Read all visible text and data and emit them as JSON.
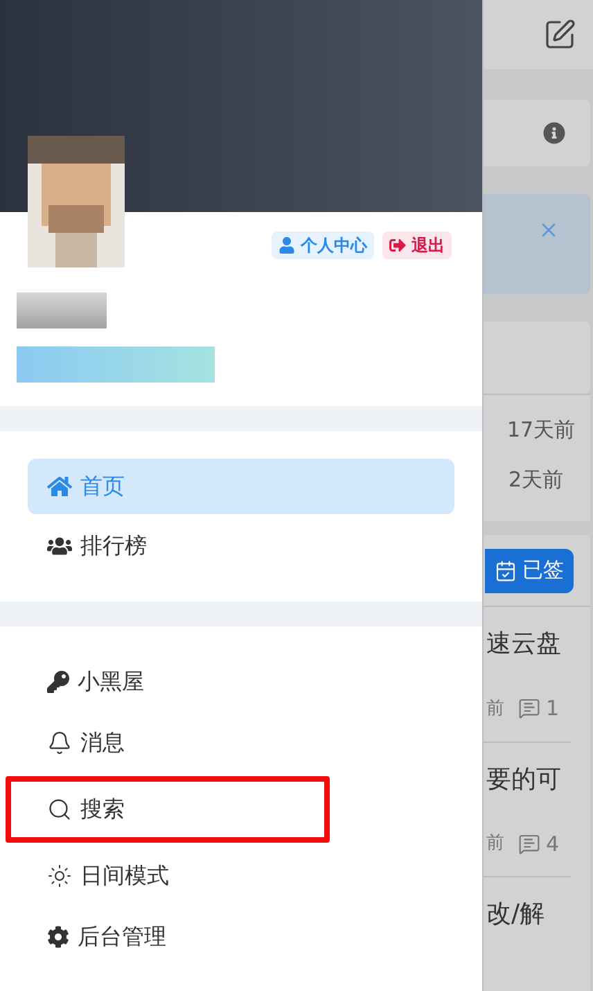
{
  "drawer": {
    "header_buttons": [
      {
        "label": "个人中心",
        "kind": "profile"
      },
      {
        "label": "退出",
        "kind": "logout"
      }
    ],
    "menu_groups": [
      [
        {
          "label": "首页",
          "kind": "home",
          "selected": true,
          "highlighted": false
        },
        {
          "label": "排行榜",
          "kind": "users",
          "selected": false,
          "highlighted": false
        }
      ],
      [
        {
          "label": "小黑屋",
          "kind": "key",
          "selected": false,
          "highlighted": false
        },
        {
          "label": "消息",
          "kind": "bell",
          "selected": false,
          "highlighted": false
        },
        {
          "label": "搜索",
          "kind": "search",
          "selected": false,
          "highlighted": true
        },
        {
          "label": "日间模式",
          "kind": "sun",
          "selected": false,
          "highlighted": false
        },
        {
          "label": "后台管理",
          "kind": "gear",
          "selected": false,
          "highlighted": false
        }
      ]
    ]
  },
  "background_page": {
    "list_times": [
      "17天前",
      "2天前"
    ],
    "sign_button": "已签",
    "posts": [
      {
        "title": "速云盘",
        "time": "前",
        "comments": "1"
      },
      {
        "title": "要的可",
        "time": "前",
        "comments": "4"
      },
      {
        "title": "改/解"
      }
    ]
  }
}
